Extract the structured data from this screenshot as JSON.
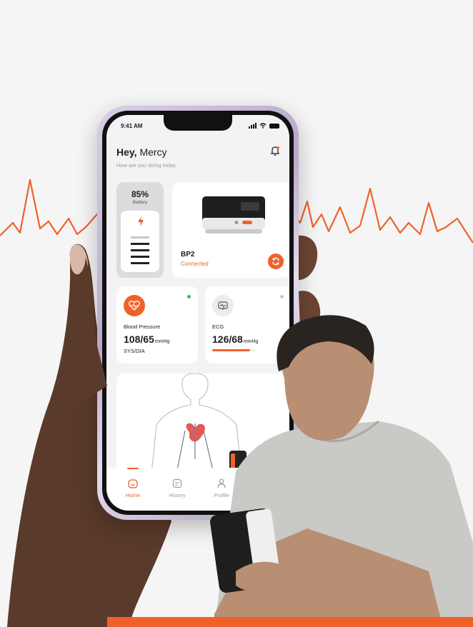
{
  "status_bar": {
    "time": "9:41 AM"
  },
  "greeting": {
    "hey": "Hey,",
    "name": "Mercy",
    "subtitle": "How are you doing today"
  },
  "battery": {
    "percent": "85%",
    "label": "Battery"
  },
  "device": {
    "name": "BP2",
    "status": "Connected"
  },
  "blood_pressure": {
    "title": "Blood Pressure",
    "value": "108/65",
    "unit": "mmHg",
    "sub": "SYS/DIA"
  },
  "ecg": {
    "title": "ECG",
    "value": "126/68",
    "unit": "mmHg"
  },
  "tabs": [
    {
      "label": "Home",
      "icon": "home-icon"
    },
    {
      "label": "History",
      "icon": "history-icon"
    },
    {
      "label": "Profile",
      "icon": "profile-icon"
    }
  ],
  "colors": {
    "accent": "#f0612a",
    "connected_dot": "#3dbb57"
  }
}
